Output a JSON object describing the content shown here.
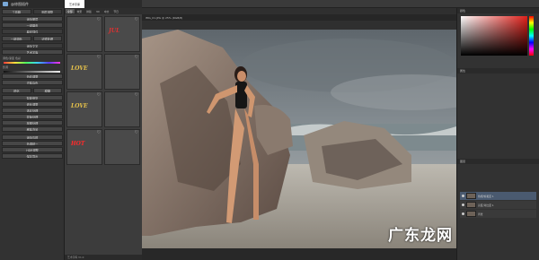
{
  "left_panel": {
    "title": "@修图插件",
    "tool_labels": [
      "工具箱",
      "图层调整"
    ],
    "buttons": [
      "添加图层",
      "一键磨皮",
      "磨皮插件",
      "一键调色",
      "滤镜处理",
      "添加文字",
      "艺术字库"
    ],
    "section_color": "调色/渐变 色彩",
    "section_tone": "影调",
    "buttons2": [
      "色彩调整",
      "去除杂色"
    ],
    "pair1": [
      "锐化",
      "模糊"
    ],
    "buttons3": [
      "智能修复",
      "液化调整",
      "选区处理",
      "蒙版处理",
      "抠图处理",
      "移除背景"
    ],
    "buttons4": [
      "添加边框",
      "色调统一",
      "HDR调整",
      "保存导出"
    ]
  },
  "tabstrip": {
    "active_tab": "艺术字库"
  },
  "mid_panel": {
    "tabs": [
      "全部",
      "效果",
      "排版",
      "3D",
      "中文",
      "节日"
    ],
    "cells": [
      {
        "text": "",
        "color": "#cccccc",
        "name": "gray-text-style"
      },
      {
        "text": "JUL",
        "color": "#e03030",
        "name": "red-script"
      },
      {
        "text": "LOVE",
        "color": "#e8c34a",
        "name": "gold-serif"
      },
      {
        "text": "",
        "color": "#ffffff",
        "name": "white-script"
      },
      {
        "text": "LOVE",
        "color": "#e8c34a",
        "name": "gold-bold"
      },
      {
        "text": "",
        "color": "#aaaaaa",
        "name": "arrow-icon"
      },
      {
        "text": "HOT",
        "color": "#ff2a2a",
        "name": "red-brush"
      },
      {
        "text": "",
        "color": "#d9b76a",
        "name": "gold-panel"
      }
    ],
    "footer": "艺术字库 V1.0"
  },
  "doc": {
    "title": "IMG_01.JPG @ 25% (RGB/8)"
  },
  "right_panel": {
    "color_title": "颜色",
    "props_title": "属性",
    "layers_title": "图层",
    "layers": [
      "色相/饱和度 1",
      "亮度/对比度 1",
      "背景"
    ]
  },
  "watermark": "广东龙网",
  "colors": {
    "picker_hue": "#e0201a"
  }
}
